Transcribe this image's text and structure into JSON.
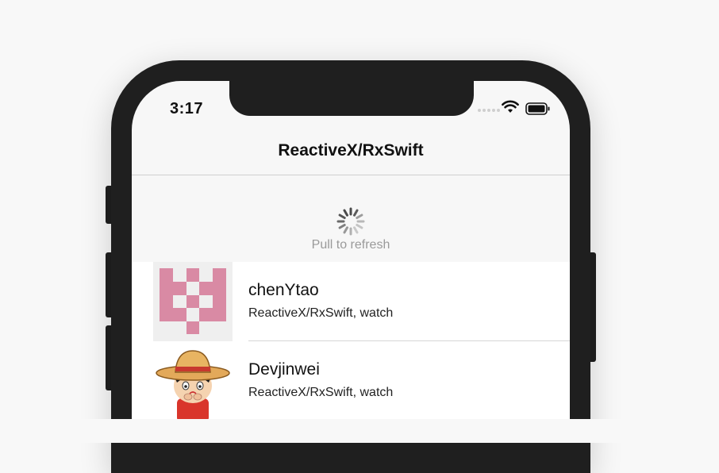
{
  "status_bar": {
    "time": "3:17",
    "wifi_icon": "wifi-icon",
    "battery_icon": "battery-icon"
  },
  "nav": {
    "title": "ReactiveX/RxSwift"
  },
  "refresh": {
    "label": "Pull to refresh",
    "icon": "activity-spinner-icon"
  },
  "rows": [
    {
      "name": "chenYtao",
      "subtitle": "ReactiveX/RxSwift, watch",
      "avatar_color": "#d98aa4"
    },
    {
      "name": "Devjinwei",
      "subtitle": "ReactiveX/RxSwift, watch"
    }
  ]
}
